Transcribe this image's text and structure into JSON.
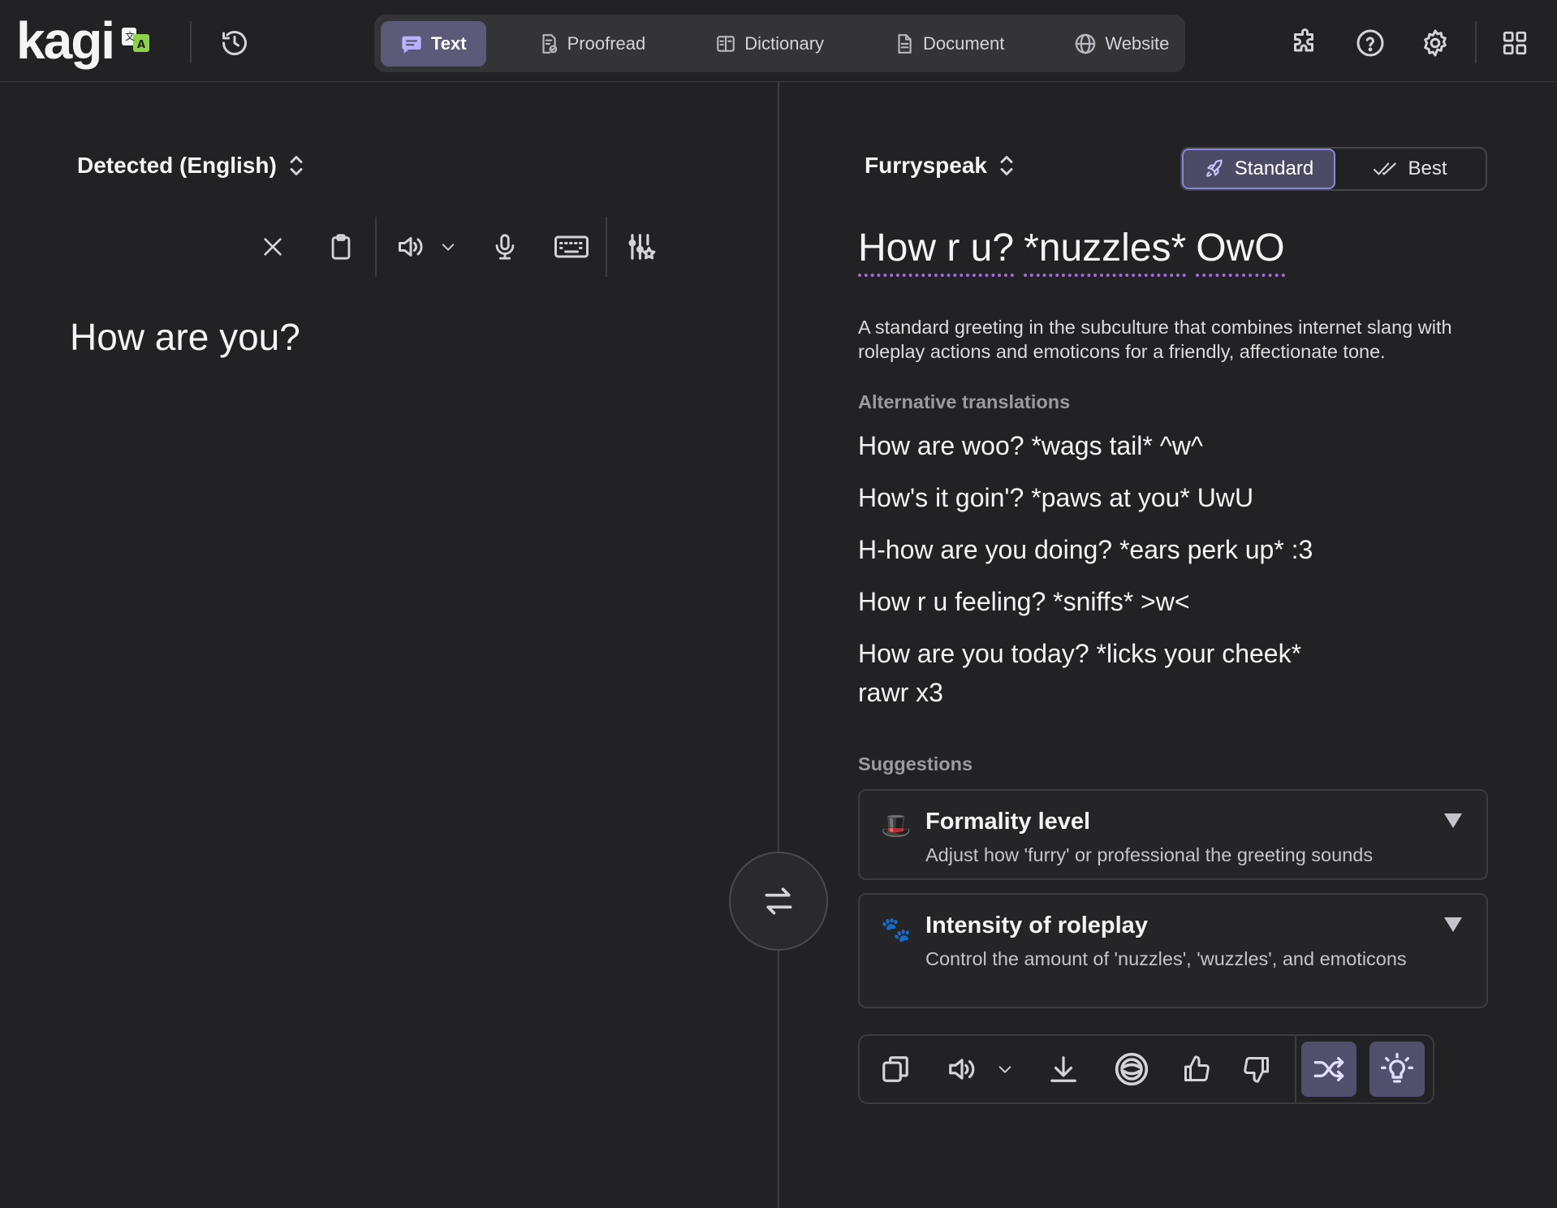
{
  "header": {
    "logo": "kagi",
    "tabs": [
      {
        "label": "Text",
        "icon": "chat-bubble-icon",
        "active": true
      },
      {
        "label": "Proofread",
        "icon": "proofread-icon",
        "active": false
      },
      {
        "label": "Dictionary",
        "icon": "book-icon",
        "active": false
      },
      {
        "label": "Document",
        "icon": "document-icon",
        "active": false
      },
      {
        "label": "Website",
        "icon": "globe-icon",
        "active": false
      }
    ],
    "right_icons": [
      "puzzle-icon",
      "help-icon",
      "gear-icon",
      "apps-grid-icon"
    ]
  },
  "source": {
    "language": "Detected (English)",
    "text": "How are you?",
    "toolbar": [
      "clear-icon",
      "clipboard-icon",
      "speaker-icon",
      "chevron-down-icon",
      "microphone-icon",
      "keyboard-icon",
      "settings-sliders-icon"
    ]
  },
  "target": {
    "language": "Furryspeak",
    "quality": {
      "standard": "Standard",
      "best": "Best",
      "selected": "Standard"
    },
    "translation_words": [
      "How r u?",
      "*nuzzles*",
      "OwO"
    ],
    "explanation": "A standard greeting in the subculture that combines internet slang with roleplay actions and emoticons for a friendly, affectionate tone.",
    "alternatives_label": "Alternative translations",
    "alternatives": [
      "How are woo? *wags tail* ^w^",
      "How's it goin'? *paws at you* UwU",
      "H-how are you doing? *ears perk up* :3",
      "How r u feeling? *sniffs* >w<",
      "How are you today? *licks your cheek* rawr x3"
    ],
    "suggestions_label": "Suggestions",
    "suggestions": [
      {
        "icon": "🎩",
        "title": "Formality level",
        "description": "Adjust how 'furry' or professional the greeting sounds"
      },
      {
        "icon": "🐾",
        "title": "Intensity of roleplay",
        "description": "Control the amount of 'nuzzles', 'wuzzles', and emoticons"
      }
    ],
    "toolbar": [
      "copy-icon",
      "speaker-icon",
      "chevron-down-icon",
      "download-icon",
      "kagi-assistant-icon",
      "thumbs-up-icon",
      "thumbs-down-icon",
      "shuffle-icon",
      "lightbulb-icon"
    ]
  },
  "colors": {
    "background": "#222224",
    "accent": "#5b5a78",
    "underline": "#a268e6"
  }
}
